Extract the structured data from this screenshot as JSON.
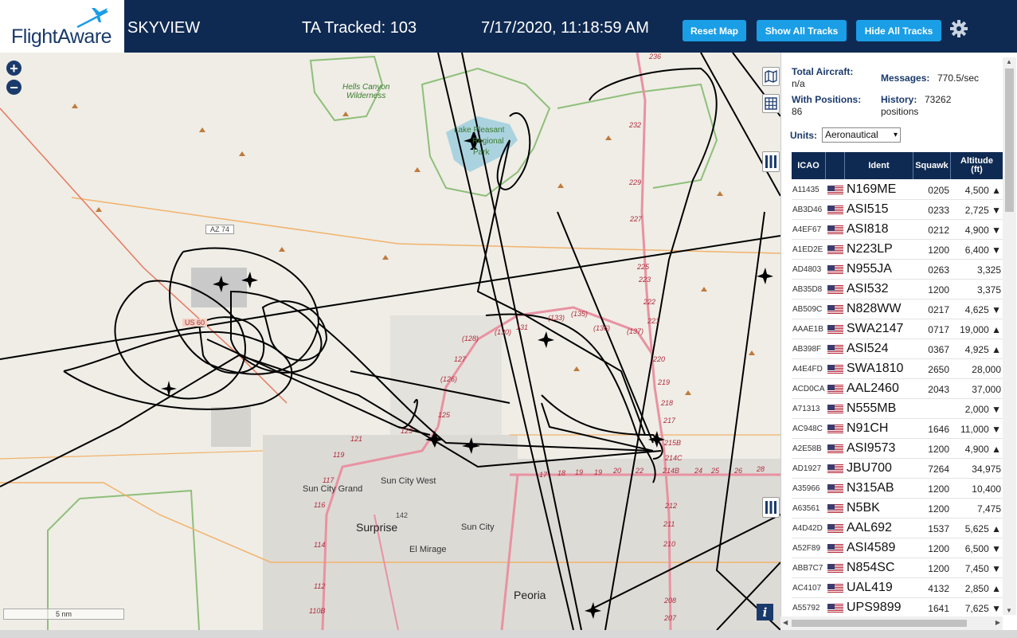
{
  "header": {
    "logo_text": "FlightAware",
    "app_name": "SKYVIEW",
    "tracked": "TA Tracked: 103",
    "datetime": "7/17/2020, 11:18:59 AM",
    "buttons": {
      "reset": "Reset Map",
      "show": "Show All Tracks",
      "hide": "Hide All Tracks"
    },
    "colors": {
      "bar": "#0f2a52",
      "button": "#1a9ee6"
    }
  },
  "map": {
    "zoom_in": "+",
    "zoom_out": "−",
    "scale_label": "5 nm",
    "info_label": "i",
    "labels": {
      "hells_canyon": "Hells Canyon",
      "wilderness": "Wilderness",
      "lake": "Lake Pleasant",
      "regional": "Regional",
      "park": "Park",
      "az74": "AZ 74",
      "us60": "US 60",
      "sun_city_grand": "Sun City Grand",
      "sun_city_west": "Sun City West",
      "surprise": "Surprise",
      "sun_city": "Sun City",
      "el_mirage": "El Mirage",
      "peoria": "Peoria",
      "r128": "(128)",
      "r126": "(126)",
      "r130": "(130)",
      "r131": "131",
      "r133": "(133)",
      "r135": "(135)",
      "r136": "(136)",
      "r137": "(137)",
      "e127": "127",
      "e125": "125",
      "e123": "123",
      "e121": "121",
      "e119": "119",
      "e117": "117",
      "e116": "116",
      "e114": "114",
      "e112": "112",
      "e110b": "110B",
      "e236": "236",
      "e232": "232",
      "e229": "229",
      "e227": "227",
      "e225": "225",
      "e223": "223",
      "e222": "222",
      "e221": "221",
      "e220": "220",
      "e219": "219",
      "e218": "218",
      "e217": "217",
      "e215b": "215B",
      "e214c": "214C",
      "e214b": "214B",
      "e212": "212",
      "e211": "211",
      "e210": "210",
      "e208": "208",
      "e207": "207",
      "e142": "142",
      "e17": "17",
      "e18": "18",
      "e19": "19",
      "e20": "20",
      "e22": "22",
      "e24": "24",
      "e25": "25",
      "e26": "26",
      "e28": "28"
    }
  },
  "panel": {
    "total_aircraft_label": "Total Aircraft:",
    "total_aircraft_value": "n/a",
    "messages_label": "Messages:",
    "messages_value": "770.5/sec",
    "with_positions_label": "With Positions:",
    "with_positions_value": "86",
    "history_label": "History:",
    "history_value": "73262",
    "history_unit": "positions",
    "units_label": "Units:",
    "units_value": "Aeronautical",
    "columns": {
      "icao": "ICAO",
      "ident": "Ident",
      "squawk": "Squawk",
      "altitude": "Altitude",
      "altitude_unit": "(ft)"
    },
    "rows": [
      {
        "icao": "A11435",
        "ident": "N169ME",
        "squawk": "0205",
        "alt": "4,500 ▲"
      },
      {
        "icao": "AB3D46",
        "ident": "ASI515",
        "squawk": "0233",
        "alt": "2,725 ▼"
      },
      {
        "icao": "A4EF67",
        "ident": "ASI818",
        "squawk": "0212",
        "alt": "4,900 ▼"
      },
      {
        "icao": "A1ED2E",
        "ident": "N223LP",
        "squawk": "1200",
        "alt": "6,400 ▼"
      },
      {
        "icao": "AD4803",
        "ident": "N955JA",
        "squawk": "0263",
        "alt": "3,325"
      },
      {
        "icao": "AB35D8",
        "ident": "ASI532",
        "squawk": "1200",
        "alt": "3,375"
      },
      {
        "icao": "AB509C",
        "ident": "N828WW",
        "squawk": "0217",
        "alt": "4,625 ▼"
      },
      {
        "icao": "AAAE1B",
        "ident": "SWA2147",
        "squawk": "0717",
        "alt": "19,000 ▲"
      },
      {
        "icao": "AB398F",
        "ident": "ASI524",
        "squawk": "0367",
        "alt": "4,925 ▲"
      },
      {
        "icao": "A4E4FD",
        "ident": "SWA1810",
        "squawk": "2650",
        "alt": "28,000"
      },
      {
        "icao": "ACD0CA",
        "ident": "AAL2460",
        "squawk": "2043",
        "alt": "37,000"
      },
      {
        "icao": "A71313",
        "ident": "N555MB",
        "squawk": "",
        "alt": "2,000 ▼"
      },
      {
        "icao": "AC948C",
        "ident": "N91CH",
        "squawk": "1646",
        "alt": "11,000 ▼"
      },
      {
        "icao": "A2E58B",
        "ident": "ASI9573",
        "squawk": "1200",
        "alt": "4,900 ▲"
      },
      {
        "icao": "AD1927",
        "ident": "JBU700",
        "squawk": "7264",
        "alt": "34,975"
      },
      {
        "icao": "A35966",
        "ident": "N315AB",
        "squawk": "1200",
        "alt": "10,400"
      },
      {
        "icao": "A63561",
        "ident": "N5BK",
        "squawk": "1200",
        "alt": "7,475"
      },
      {
        "icao": "A4D42D",
        "ident": "AAL692",
        "squawk": "1537",
        "alt": "5,625 ▲"
      },
      {
        "icao": "A52F89",
        "ident": "ASI4589",
        "squawk": "1200",
        "alt": "6,500 ▼"
      },
      {
        "icao": "ABB7C7",
        "ident": "N854SC",
        "squawk": "1200",
        "alt": "7,450 ▼"
      },
      {
        "icao": "AC4107",
        "ident": "UAL419",
        "squawk": "4132",
        "alt": "2,850 ▲"
      },
      {
        "icao": "A55792",
        "ident": "UPS9899",
        "squawk": "1641",
        "alt": "7,625 ▼"
      }
    ]
  }
}
